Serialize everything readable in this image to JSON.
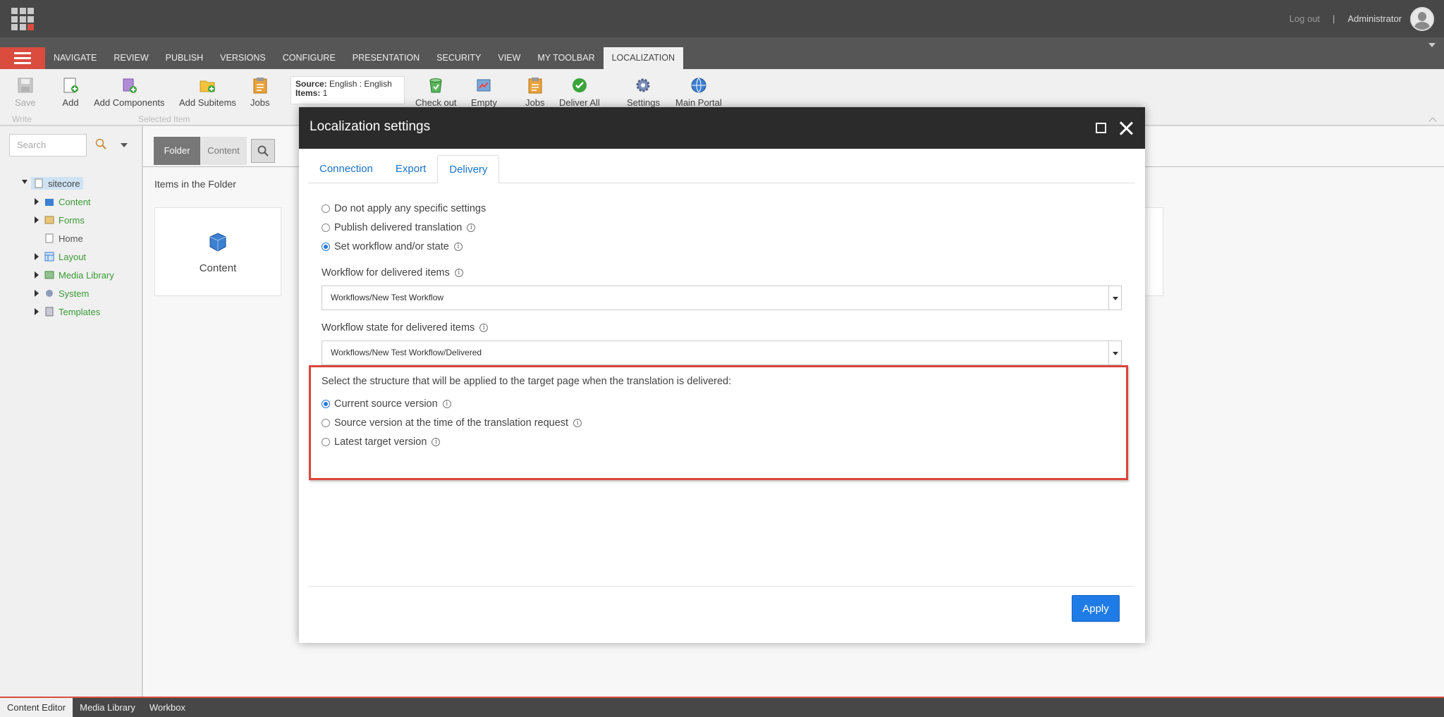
{
  "header": {
    "logout_label": "Log out",
    "separator": "|",
    "user_name": "Administrator"
  },
  "ribbon": {
    "tabs": [
      "NAVIGATE",
      "REVIEW",
      "PUBLISH",
      "VERSIONS",
      "CONFIGURE",
      "PRESENTATION",
      "SECURITY",
      "VIEW",
      "MY TOOLBAR",
      "LOCALIZATION"
    ],
    "active_tab": "LOCALIZATION",
    "buttons": {
      "save": "Save",
      "add": "Add",
      "add_components": "Add Components",
      "add_subitems": "Add Subitems",
      "jobs": "Jobs",
      "check_out": "Check out",
      "empty": "Empty",
      "jobs2": "Jobs",
      "deliver_all": "Deliver All",
      "settings": "Settings",
      "main_portal": "Main Portal"
    },
    "groups": {
      "write": "Write",
      "selected_item": "Selected Item"
    },
    "source_box": {
      "source_key": "Source:",
      "source_value": "English : English",
      "items_key": "Items:",
      "items_value": "1"
    }
  },
  "left_panel": {
    "search_placeholder": "Search",
    "tree": {
      "root": "sitecore",
      "children": [
        "Content",
        "Forms",
        "Home",
        "Layout",
        "Media Library",
        "System",
        "Templates"
      ]
    }
  },
  "content": {
    "tabs": [
      "Folder",
      "Content"
    ],
    "active_tab": "Folder",
    "items_title": "Items in the Folder",
    "card_label": "Content"
  },
  "bottom_bar": {
    "tabs": [
      "Content Editor",
      "Media Library",
      "Workbox"
    ],
    "active_tab": "Content Editor"
  },
  "dialog": {
    "title": "Localization settings",
    "tabs": [
      "Connection",
      "Export",
      "Delivery"
    ],
    "active_tab": "Delivery",
    "delivery_options": [
      {
        "label": "Do not apply any specific settings",
        "selected": false,
        "info": false
      },
      {
        "label": "Publish delivered translation",
        "selected": false,
        "info": true
      },
      {
        "label": "Set workflow and/or state",
        "selected": true,
        "info": true
      }
    ],
    "workflow_label": "Workflow for delivered items",
    "workflow_value": "Workflows/New Test Workflow",
    "workflow_state_label": "Workflow state for delivered items",
    "workflow_state_value": "Workflows/New Test Workflow/Delivered",
    "structure_label": "Select the structure that will be applied to the target page when the translation is delivered:",
    "structure_options": [
      {
        "label": "Current source version",
        "selected": true
      },
      {
        "label": "Source version at the time of the translation request",
        "selected": false
      },
      {
        "label": "Latest target version",
        "selected": false
      }
    ],
    "apply_label": "Apply",
    "info_glyph": "i"
  },
  "colors": {
    "accent_red": "#d94c3e",
    "highlight_red": "#d9463d",
    "link_blue": "#1a73c8",
    "apply_blue": "#1f7be6",
    "tree_green": "#3a9a34"
  }
}
